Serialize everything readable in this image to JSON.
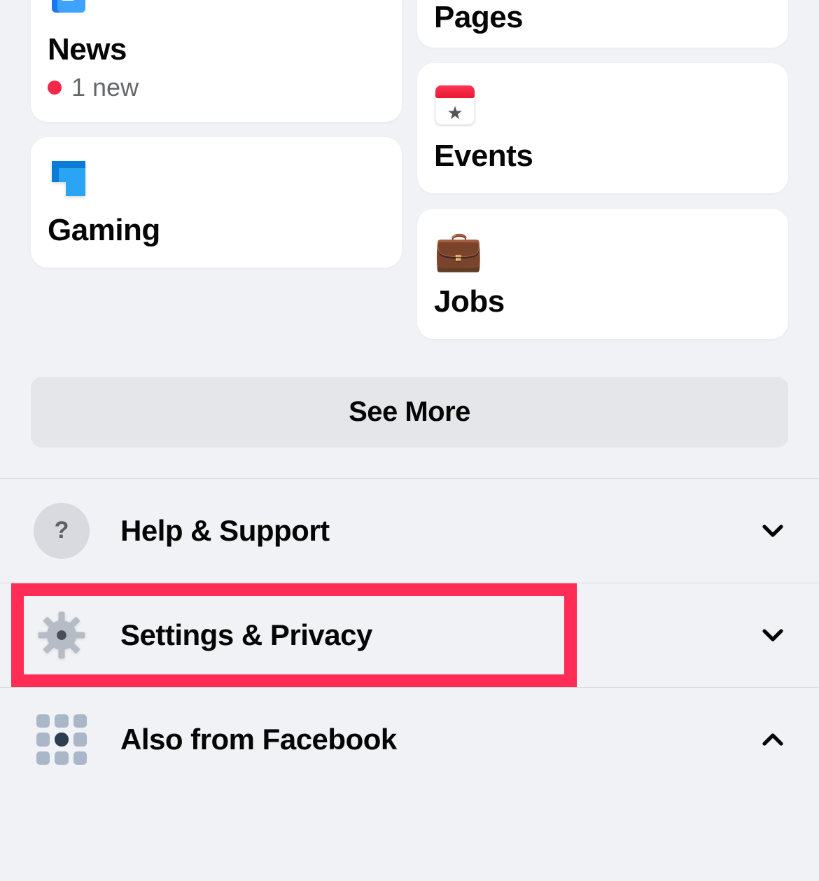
{
  "shortcuts": {
    "news": {
      "title": "News",
      "badge_text": "1 new"
    },
    "gaming": {
      "title": "Gaming"
    },
    "pages": {
      "title": "Pages"
    },
    "events": {
      "title": "Events"
    },
    "jobs": {
      "title": "Jobs"
    }
  },
  "see_more_label": "See More",
  "menu": {
    "help": {
      "label": "Help & Support",
      "expanded": false
    },
    "settings": {
      "label": "Settings & Privacy",
      "expanded": false,
      "highlighted": true
    },
    "also": {
      "label": "Also from Facebook",
      "expanded": true
    }
  }
}
